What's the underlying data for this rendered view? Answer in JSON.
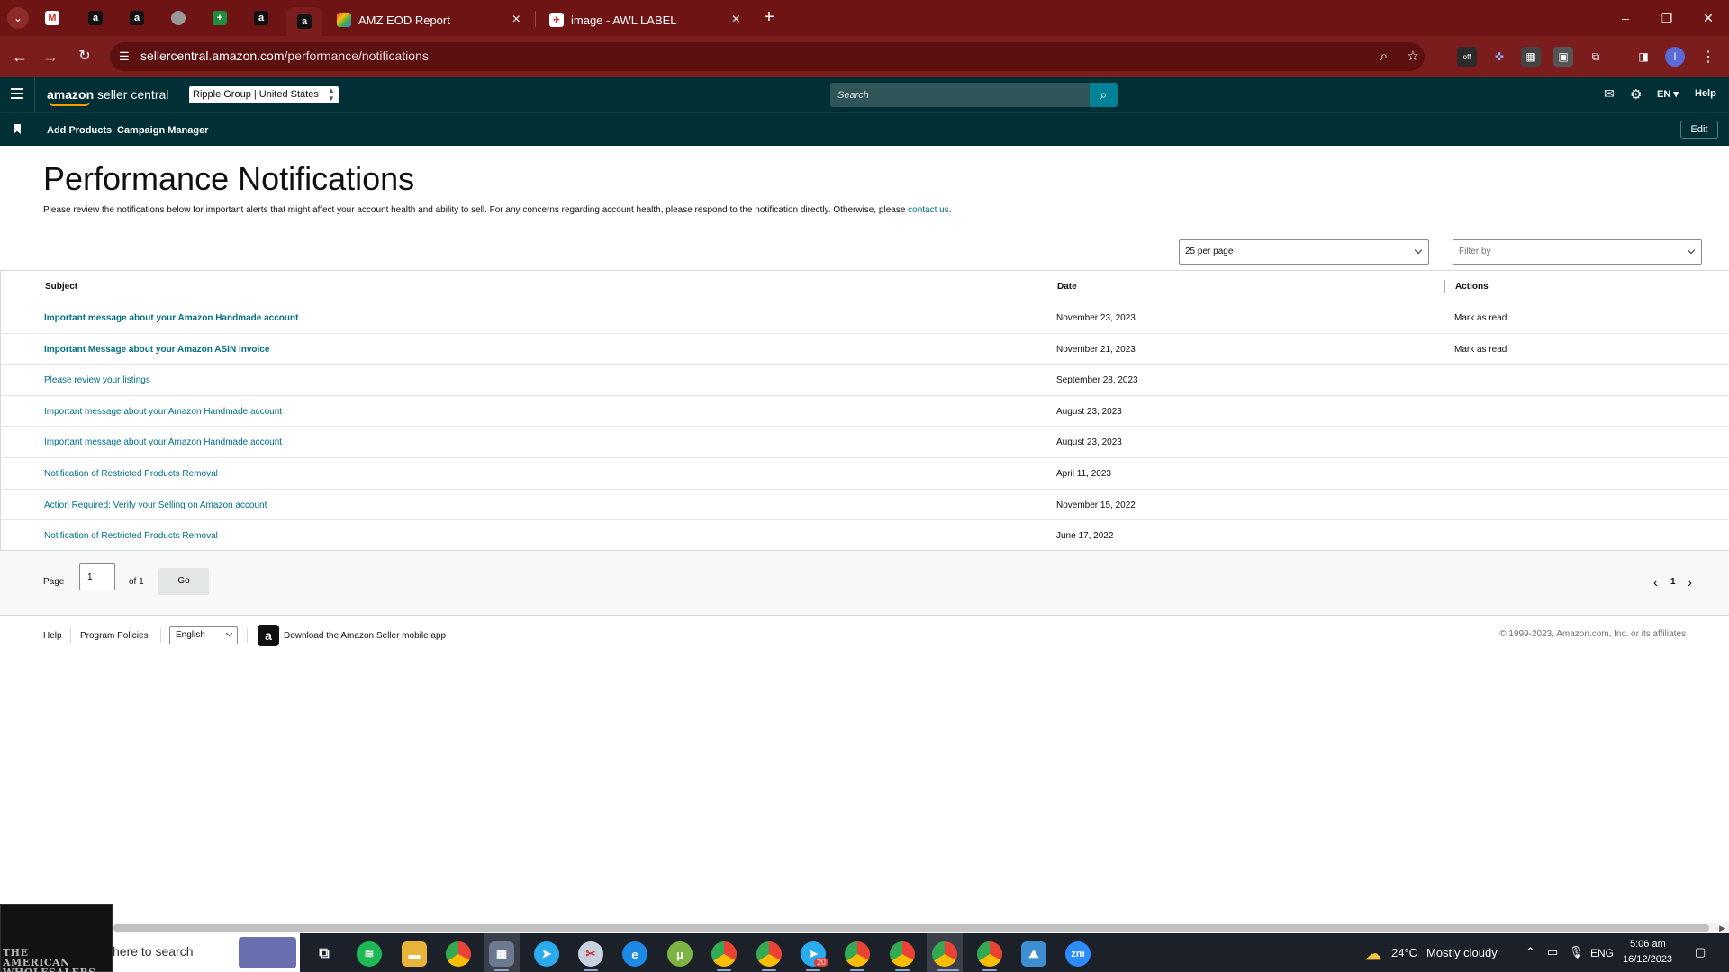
{
  "browser": {
    "tabs": [
      {
        "title": "AMZ EOD Report",
        "close": "×",
        "favicon": "multicolor-logo-icon"
      },
      {
        "title": "image - AWL LABEL",
        "close": "×",
        "favicon": "red-logo-icon"
      }
    ],
    "pinned_favicons": [
      "gmail-icon",
      "amazon-icon",
      "amazon-icon",
      "gray-globe-icon",
      "sheets-icon",
      "amazon-icon",
      "amazon-icon"
    ],
    "url_domain": "sellercentral.amazon.com",
    "url_path": "/performance/notifications",
    "new_tab": "+",
    "window": {
      "minimize": "–",
      "restore": "❐",
      "close": "✕"
    },
    "ext_off_badge": "off",
    "profile_initial": "I"
  },
  "header": {
    "brand_strong": "amazon",
    "brand_rest": " seller central",
    "account": "Ripple Group | United States",
    "search_placeholder": "Search",
    "lang": "EN",
    "help": "Help"
  },
  "subnav": {
    "links": [
      "Add Products",
      "Campaign Manager"
    ],
    "edit": "Edit"
  },
  "page": {
    "title": "Performance Notifications",
    "description": "Please review the notifications below for important alerts that might affect your account health and ability to sell. For any concerns regarding account health, please respond to the notification directly. Otherwise, please ",
    "contact_link": "contact us",
    "description_end": "."
  },
  "controls": {
    "per_page": "25 per page",
    "filter_placeholder": "Filter by"
  },
  "table": {
    "columns": [
      "Subject",
      "Date",
      "Actions"
    ],
    "rows": [
      {
        "subject": "Important message about your Amazon Handmade account",
        "date": "November 23, 2023",
        "action": "Mark as read",
        "unread": true
      },
      {
        "subject": "Important Message about your Amazon ASIN invoice",
        "date": "November 21, 2023",
        "action": "Mark as read",
        "unread": true
      },
      {
        "subject": "Please review your listings",
        "date": "September 28, 2023",
        "action": "",
        "unread": false
      },
      {
        "subject": "Important message about your Amazon Handmade account",
        "date": "August 23, 2023",
        "action": "",
        "unread": false
      },
      {
        "subject": "Important message about your Amazon Handmade account",
        "date": "August 23, 2023",
        "action": "",
        "unread": false
      },
      {
        "subject": "Notification of Restricted Products Removal",
        "date": "April 11, 2023",
        "action": "",
        "unread": false
      },
      {
        "subject": "Action Required: Verify your Selling on Amazon account",
        "date": "November 15, 2022",
        "action": "",
        "unread": false
      },
      {
        "subject": "Notification of Restricted Products Removal",
        "date": "June 17, 2022",
        "action": "",
        "unread": false
      }
    ]
  },
  "pagination": {
    "page_label": "Page",
    "page_value": "1",
    "of_label": "of 1",
    "go": "Go",
    "prev": "‹",
    "current": "1",
    "next": "›"
  },
  "footer": {
    "help": "Help",
    "policies": "Program Policies",
    "language": "English",
    "app_text": "Download the Amazon Seller mobile app",
    "copyright": "© 1999-2023, Amazon.com, Inc. or its affiliates"
  },
  "taskbar": {
    "widget_text": "THE\nAMERICAN\nWHOLESALERS",
    "search_text": "here to search",
    "weather_temp": "24°C",
    "weather_desc": "Mostly cloudy",
    "lang": "ENG",
    "time": "5:06 am",
    "date": "16/12/2023",
    "badges": {
      "telegram": "20"
    }
  },
  "colors": {
    "tabbar": "#6f1414",
    "addressbar": "#7c1d1d",
    "seller_header": "#002f36",
    "link": "#007185",
    "search_button": "#008296"
  }
}
